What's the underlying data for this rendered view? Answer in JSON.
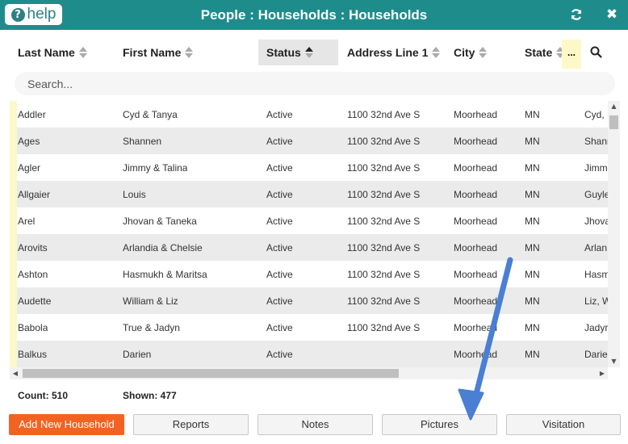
{
  "titlebar": {
    "help_label": "help",
    "help_glyph": "?",
    "title": "People : Households : Households",
    "refresh_icon": "refresh-icon",
    "close_icon": "close-icon",
    "bg_color": "#1f8c8c"
  },
  "columns": [
    {
      "label": "Last Name"
    },
    {
      "label": "First Name"
    },
    {
      "label": "Status",
      "sorted": "asc"
    },
    {
      "label": "Address Line 1"
    },
    {
      "label": "City"
    },
    {
      "label": "State"
    }
  ],
  "more_label": "...",
  "search": {
    "placeholder": "Search..."
  },
  "rows": [
    {
      "last": "Addler",
      "first": "Cyd & Tanya",
      "status": "Active",
      "address": "1100 32nd Ave S",
      "city": "Moorhead",
      "state": "MN",
      "extra": "Cyd, I"
    },
    {
      "last": "Ages",
      "first": "Shannen",
      "status": "Active",
      "address": "1100 32nd Ave S",
      "city": "Moorhead",
      "state": "MN",
      "extra": "Shann"
    },
    {
      "last": "Agler",
      "first": "Jimmy & Talina",
      "status": "Active",
      "address": "1100 32nd Ave S",
      "city": "Moorhead",
      "state": "MN",
      "extra": "Jimm"
    },
    {
      "last": "Allgaier",
      "first": "Louis",
      "status": "Active",
      "address": "1100 32nd Ave S",
      "city": "Moorhead",
      "state": "MN",
      "extra": "Guyle"
    },
    {
      "last": "Arel",
      "first": "Jhovan & Taneka",
      "status": "Active",
      "address": "1100 32nd Ave S",
      "city": "Moorhead",
      "state": "MN",
      "extra": "Jhova"
    },
    {
      "last": "Arovits",
      "first": "Arlandia & Chelsie",
      "status": "Active",
      "address": "1100 32nd Ave S",
      "city": "Moorhead",
      "state": "MN",
      "extra": "Arlan"
    },
    {
      "last": "Ashton",
      "first": "Hasmukh & Maritsa",
      "status": "Active",
      "address": "1100 32nd Ave S",
      "city": "Moorhead",
      "state": "MN",
      "extra": "Hasm"
    },
    {
      "last": "Audette",
      "first": "William & Liz",
      "status": "Active",
      "address": "1100 32nd Ave S",
      "city": "Moorhead",
      "state": "MN",
      "extra": "Liz, W"
    },
    {
      "last": "Babola",
      "first": "True & Jadyn",
      "status": "Active",
      "address": "1100 32nd Ave S",
      "city": "Moorhead",
      "state": "MN",
      "extra": "Jadyr"
    },
    {
      "last": "Balkus",
      "first": "Darien",
      "status": "Active",
      "address": "",
      "city": "Moorhead",
      "state": "MN",
      "extra": "Darie"
    }
  ],
  "footer": {
    "count": "Count: 510",
    "shown": "Shown: 477",
    "buttons": [
      "Add New Household",
      "Reports",
      "Notes",
      "Pictures",
      "Visitation"
    ]
  },
  "colors": {
    "accent": "#f26322",
    "row_marker": "#fdf8c8",
    "annotation_arrow": "#4a7fd4"
  }
}
